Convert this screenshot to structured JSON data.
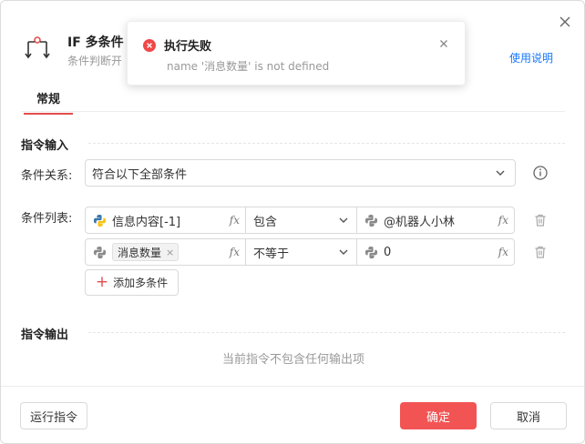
{
  "header": {
    "title": "IF 多条件",
    "subtitle": "条件判断开",
    "help_link": "使用说明"
  },
  "tabs": [
    {
      "label": "常规",
      "active": true
    }
  ],
  "sections": {
    "input_title": "指令输入",
    "output_title": "指令输出"
  },
  "condition_relation": {
    "label": "条件关系:",
    "value": "符合以下全部条件"
  },
  "condition_list": {
    "label": "条件列表:",
    "rows": [
      {
        "left_value": "信息内容[-1]",
        "left_is_tag": false,
        "operator": "包含",
        "right_value": "@机器人小林"
      },
      {
        "left_value": "消息数量",
        "left_is_tag": true,
        "operator": "不等于",
        "right_value": "0"
      }
    ],
    "add_button": "添加多条件"
  },
  "output": {
    "empty_text": "当前指令不包含任何输出项"
  },
  "footer": {
    "run_button": "运行指令",
    "ok_button": "确定",
    "cancel_button": "取消"
  },
  "toast": {
    "title": "执行失败",
    "message": "name '消息数量' is not defined"
  },
  "icons": {
    "fx_glyph": "fx",
    "tag_close_glyph": "×"
  },
  "colors": {
    "accent": "#e34d4d",
    "primary_button": "#f25454",
    "link": "#1677ff",
    "error": "#f04848",
    "python_blue": "#3b77a8",
    "python_yellow": "#f5c518"
  }
}
